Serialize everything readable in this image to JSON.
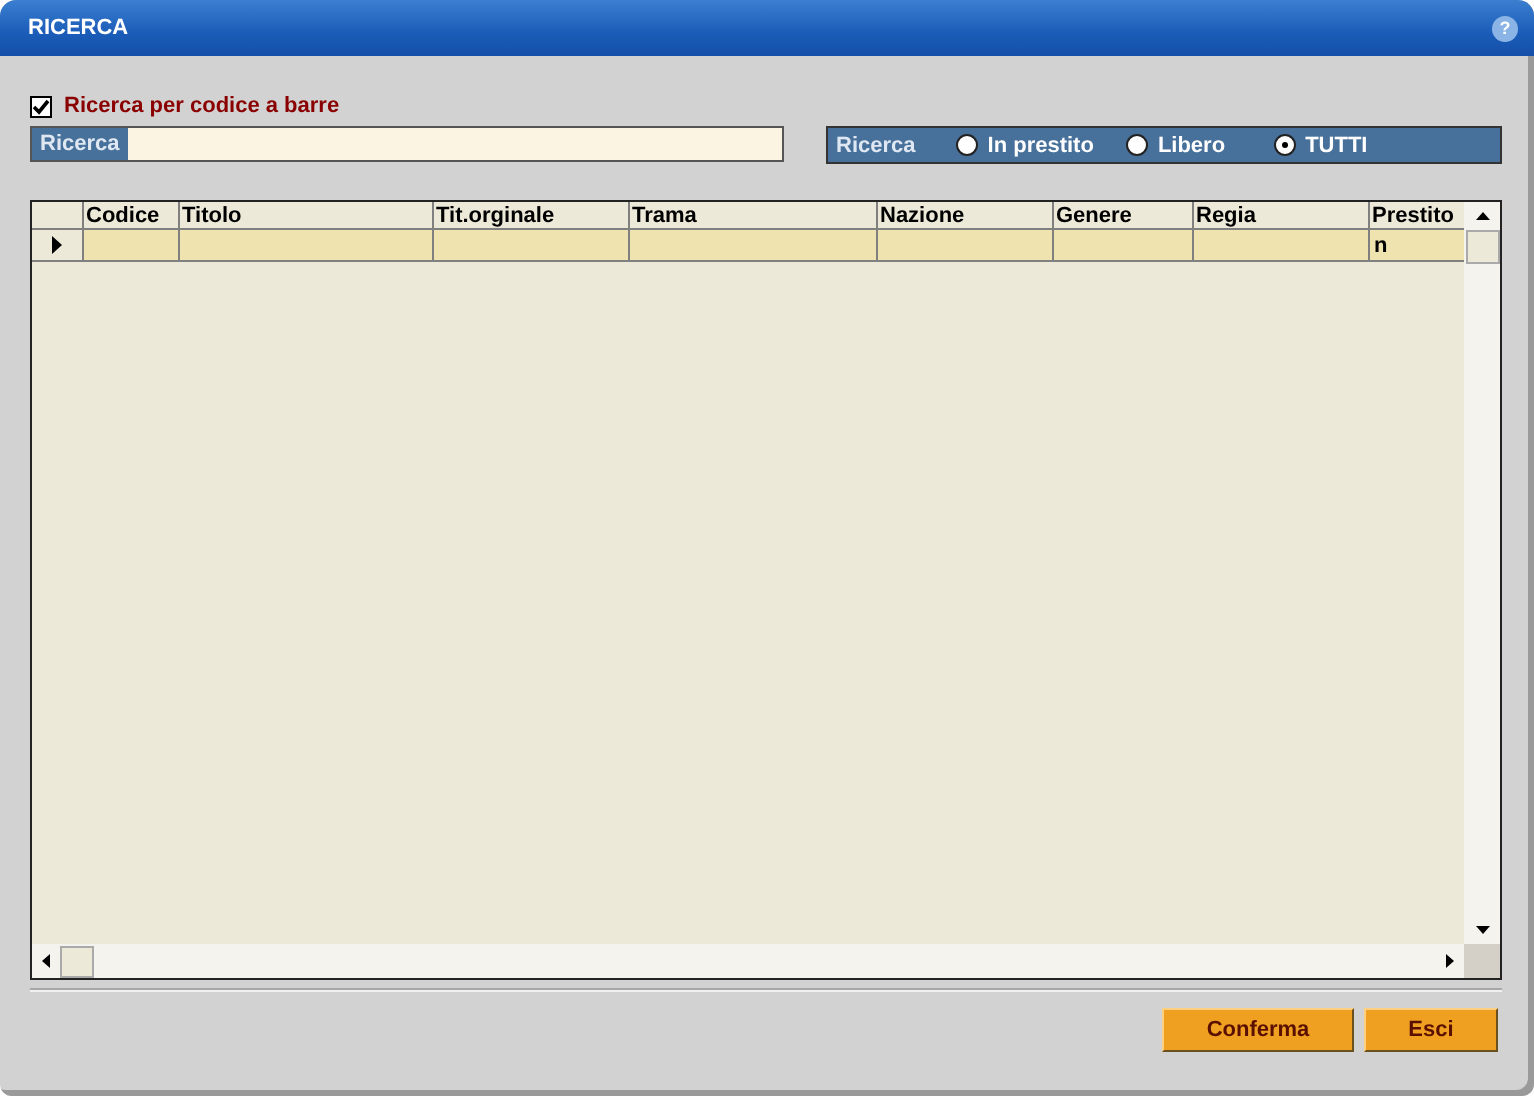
{
  "window": {
    "title": "RICERCA",
    "help": "?"
  },
  "barcode_checkbox": {
    "label": "Ricerca per codice a barre",
    "checked": true
  },
  "search": {
    "label": "Ricerca"
  },
  "filter": {
    "label": "Ricerca",
    "options": [
      {
        "label": "In prestito",
        "selected": false
      },
      {
        "label": "Libero",
        "selected": false
      },
      {
        "label": "TUTTI",
        "selected": true
      }
    ]
  },
  "table": {
    "columns": [
      "Codice",
      "Titolo",
      "Tit.orginale",
      "Trama",
      "Nazione",
      "Genere",
      "Regia",
      "Prestito"
    ],
    "rows": [
      {
        "selected": true,
        "prestito": "n"
      }
    ]
  },
  "buttons": [
    "Conferma",
    "Esci"
  ]
}
